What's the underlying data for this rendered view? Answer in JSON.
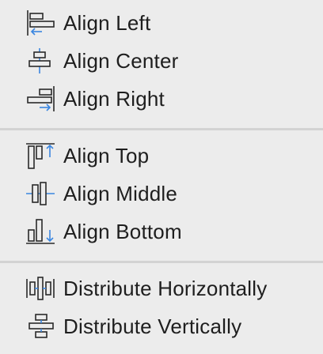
{
  "menu": {
    "groups": [
      {
        "items": [
          {
            "label": "Align Left",
            "icon": "align-left-icon"
          },
          {
            "label": "Align Center",
            "icon": "align-center-icon"
          },
          {
            "label": "Align Right",
            "icon": "align-right-icon"
          }
        ]
      },
      {
        "items": [
          {
            "label": "Align Top",
            "icon": "align-top-icon"
          },
          {
            "label": "Align Middle",
            "icon": "align-middle-icon"
          },
          {
            "label": "Align Bottom",
            "icon": "align-bottom-icon"
          }
        ]
      },
      {
        "items": [
          {
            "label": "Distribute Horizontally",
            "icon": "distribute-horizontally-icon"
          },
          {
            "label": "Distribute Vertically",
            "icon": "distribute-vertically-icon"
          }
        ]
      }
    ]
  },
  "colors": {
    "background": "#ececec",
    "text": "#1e1e1e",
    "icon_stroke": "#2a2a2a",
    "icon_accent": "#3a86e0",
    "divider": "#d3d3d3"
  }
}
